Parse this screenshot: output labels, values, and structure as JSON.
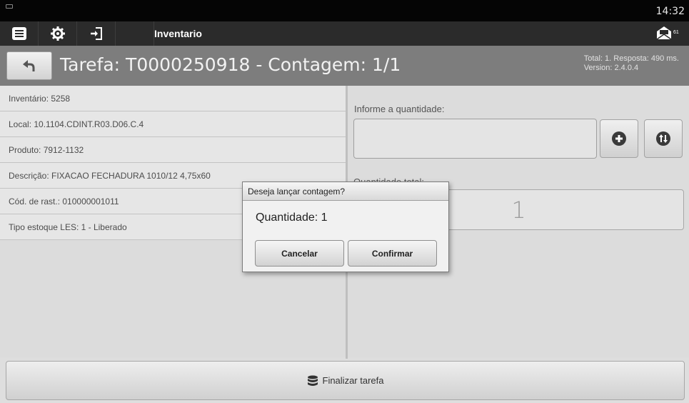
{
  "status_bar": {
    "time": "14:32"
  },
  "action_bar": {
    "title": "Inventario",
    "mail_count": "61"
  },
  "task": {
    "title": "Tarefa: T0000250918 - Contagem: 1/1",
    "total_info": "Total: 1. Resposta: 490 ms.",
    "version": "Version: 2.4.0.4"
  },
  "details": [
    "Inventário: 5258",
    "Local: 10.1104.CDINT.R03.D06.C.4",
    "Produto: 7912-1132",
    "Descrição: FIXACAO FECHADURA 1010/12 4,75x60",
    "Cód. de rast.: 010000001011",
    "Tipo estoque LES: 1 - Liberado"
  ],
  "quantity": {
    "label": "Informe a quantidade:",
    "value": ""
  },
  "total": {
    "label": "Quantidade total:",
    "value": "1"
  },
  "finalize_label": "Finalizar tarefa",
  "dialog": {
    "title": "Deseja lançar contagem?",
    "message": "Quantidade: 1",
    "cancel_label": "Cancelar",
    "confirm_label": "Confirmar"
  },
  "colors": {
    "action_bar": "#2b2b2b",
    "task_bar": "#7d7d7d",
    "status_bar": "#050505"
  }
}
